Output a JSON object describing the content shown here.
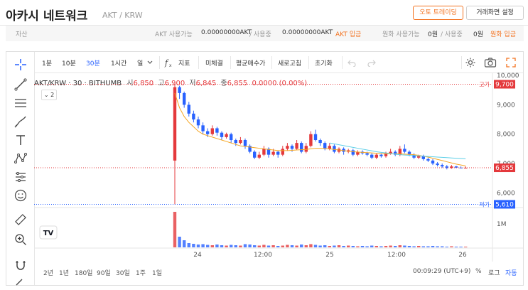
{
  "header": {
    "title": "아카시 네트워크",
    "pair": "AKT / KRW",
    "auto_trading": "오토 트레이딩",
    "layout_settings": "거래화면 설정"
  },
  "asset_bar": {
    "label": "자산",
    "coin_label": "AKT 사용가능",
    "coin_available": "0.00000000AKT",
    "coin_sep": "/ 사용중",
    "coin_in_use": "0.00000000AKT",
    "coin_deposit": "AKT 입금",
    "krw_label": "원화 사용가능",
    "krw_available": "0원",
    "krw_sep": "/ 사용중",
    "krw_in_use": "0원",
    "krw_deposit": "원화 입금"
  },
  "toolbar": {
    "intervals": [
      "1분",
      "10분",
      "30분",
      "1시간",
      "일"
    ],
    "active_interval": "30분",
    "indicators": "지표",
    "unsettled": "미체결",
    "avg_price": "평균매수가",
    "refresh": "새로고침",
    "reset": "초기화"
  },
  "legend": {
    "symbol": "AKT/KRW · 30 · BITHUMB",
    "open_label": "시",
    "open": "6,850",
    "high_label": "고",
    "high": "6,900",
    "low_label": "저",
    "low": "6,845",
    "close_label": "종",
    "close": "6,855",
    "change": "0.0000 (0.00%)",
    "collapse_count": "2"
  },
  "chart_data": {
    "type": "candlestick",
    "y_ticks": [
      "10,000",
      "9,000",
      "8,000",
      "7,000",
      "6,000"
    ],
    "y_tick_values": [
      10000,
      9000,
      8000,
      7000,
      6000
    ],
    "ylim": [
      5500,
      10100
    ],
    "x_ticks": [
      "24",
      "12:00",
      "25",
      "12:00",
      "26"
    ],
    "high_marker": {
      "label": "고가",
      "value": 9700,
      "display": "9,700"
    },
    "last_marker": {
      "value": 6855,
      "display": "6,855"
    },
    "low_marker": {
      "label": "저가",
      "value": 5610,
      "display": "5,610"
    },
    "volume_tick": "1M",
    "candles": [
      [
        7100,
        9600,
        9700,
        5610
      ],
      [
        9600,
        9400,
        9650,
        9200
      ],
      [
        9400,
        9000,
        9450,
        8900
      ],
      [
        9000,
        8700,
        9100,
        8600
      ],
      [
        8700,
        8500,
        8800,
        8400
      ],
      [
        8500,
        8300,
        8600,
        8200
      ],
      [
        8300,
        8100,
        8400,
        8000
      ],
      [
        8100,
        8000,
        8200,
        7900
      ],
      [
        8000,
        8200,
        8300,
        7950
      ],
      [
        8200,
        8050,
        8250,
        7950
      ],
      [
        8050,
        7900,
        8100,
        7800
      ],
      [
        7900,
        8000,
        8050,
        7850
      ],
      [
        8000,
        7800,
        8050,
        7700
      ],
      [
        7800,
        7700,
        7850,
        7600
      ],
      [
        7700,
        7800,
        7900,
        7650
      ],
      [
        7800,
        7600,
        7850,
        7500
      ],
      [
        7600,
        7400,
        7650,
        7350
      ],
      [
        7400,
        7200,
        7450,
        7150
      ],
      [
        7200,
        7300,
        7400,
        7150
      ],
      [
        7300,
        7500,
        7600,
        7250
      ],
      [
        7500,
        7300,
        7550,
        7200
      ],
      [
        7300,
        7400,
        7500,
        7250
      ],
      [
        7400,
        7300,
        7450,
        7200
      ],
      [
        7300,
        7500,
        7600,
        7250
      ],
      [
        7500,
        7600,
        7700,
        7450
      ],
      [
        7600,
        7500,
        7650,
        7400
      ],
      [
        7500,
        7700,
        7800,
        7450
      ],
      [
        7700,
        7400,
        7750,
        7350
      ],
      [
        7400,
        7600,
        7700,
        7350
      ],
      [
        7600,
        8000,
        8100,
        7550
      ],
      [
        8000,
        7800,
        8150,
        7750
      ],
      [
        7800,
        7700,
        7850,
        7600
      ],
      [
        7700,
        7500,
        7750,
        7450
      ],
      [
        7500,
        7600,
        7700,
        7450
      ],
      [
        7600,
        7400,
        7650,
        7350
      ],
      [
        7400,
        7500,
        7550,
        7350
      ],
      [
        7500,
        7400,
        7550,
        7300
      ],
      [
        7400,
        7450,
        7500,
        7350
      ],
      [
        7450,
        7300,
        7500,
        7250
      ],
      [
        7300,
        7400,
        7450,
        7250
      ],
      [
        7400,
        7350,
        7450,
        7300
      ],
      [
        7350,
        7300,
        7400,
        7250
      ],
      [
        7300,
        7200,
        7350,
        7150
      ],
      [
        7200,
        7300,
        7350,
        7150
      ],
      [
        7300,
        7250,
        7350,
        7200
      ],
      [
        7250,
        7350,
        7400,
        7200
      ],
      [
        7350,
        7400,
        7500,
        7300
      ],
      [
        7400,
        7300,
        7450,
        7250
      ],
      [
        7300,
        7500,
        7600,
        7250
      ],
      [
        7500,
        7400,
        7650,
        7350
      ],
      [
        7400,
        7300,
        7450,
        7250
      ],
      [
        7300,
        7200,
        7350,
        7150
      ],
      [
        7200,
        7250,
        7300,
        7150
      ],
      [
        7250,
        7150,
        7300,
        7100
      ],
      [
        7150,
        7100,
        7200,
        7050
      ],
      [
        7100,
        7000,
        7150,
        6950
      ],
      [
        7000,
        6950,
        7050,
        6900
      ],
      [
        6950,
        6900,
        7000,
        6850
      ],
      [
        6900,
        6850,
        6950,
        6800
      ],
      [
        6850,
        6900,
        6950,
        6820
      ],
      [
        6900,
        6860,
        6920,
        6840
      ],
      [
        6860,
        6850,
        6900,
        6840
      ],
      [
        6850,
        6855,
        6900,
        6845
      ]
    ],
    "ma_orange": [
      9400,
      8900,
      8600,
      8400,
      8250,
      8100,
      8000,
      7950,
      7900,
      7850,
      7800,
      7750,
      7700,
      7650,
      7600,
      7580,
      7560,
      7540,
      7520,
      7500,
      7480,
      7460,
      7440,
      7440,
      7440,
      7450,
      7460,
      7470,
      7480,
      7500,
      7520,
      7520,
      7510,
      7500,
      7480,
      7460,
      7440,
      7420,
      7400,
      7390,
      7380,
      7370,
      7360,
      7350,
      7340,
      7330,
      7330,
      7330,
      7330,
      7320,
      7310,
      7300,
      7280,
      7250,
      7220,
      7180,
      7140,
      7100,
      7060,
      7020,
      6980,
      6950,
      6920
    ],
    "ma_cyan": [
      7700,
      7670,
      7640,
      7610,
      7580,
      7550,
      7520,
      7490,
      7460,
      7430,
      7400,
      7380,
      7360,
      7340,
      7320,
      7300,
      7290,
      7280,
      7270,
      7260,
      7250,
      7240,
      7230,
      7220,
      7210,
      7200,
      7190,
      7180,
      7170,
      7160
    ],
    "volumes": [
      100,
      30,
      20,
      12,
      10,
      8,
      9,
      7,
      6,
      8,
      6,
      5,
      7,
      6,
      5,
      9,
      8,
      6,
      5,
      7,
      5,
      6,
      4,
      5,
      7,
      6,
      5,
      8,
      6,
      9,
      7,
      5,
      6,
      4,
      5,
      6,
      4,
      5,
      4,
      3,
      4,
      3,
      5,
      4,
      3,
      4,
      5,
      4,
      6,
      5,
      4,
      3,
      4,
      3,
      3,
      4,
      3,
      3,
      2,
      3,
      2,
      2,
      2
    ]
  },
  "right_tools": {
    "settings": "settings",
    "screenshot": "camera",
    "fullscreen": "expand"
  },
  "bottom": {
    "ranges": [
      "2년",
      "1년",
      "180일",
      "90일",
      "30일",
      "1주",
      "1일"
    ],
    "time": "00:09:29 (UTC+9)",
    "percent": "%",
    "log": "로그",
    "auto": "자동"
  },
  "colors": {
    "up": "#e4393c",
    "down": "#2962ff",
    "accent": "#f37321",
    "ma_orange": "#f5a623",
    "ma_cyan": "#5fd0e8"
  }
}
